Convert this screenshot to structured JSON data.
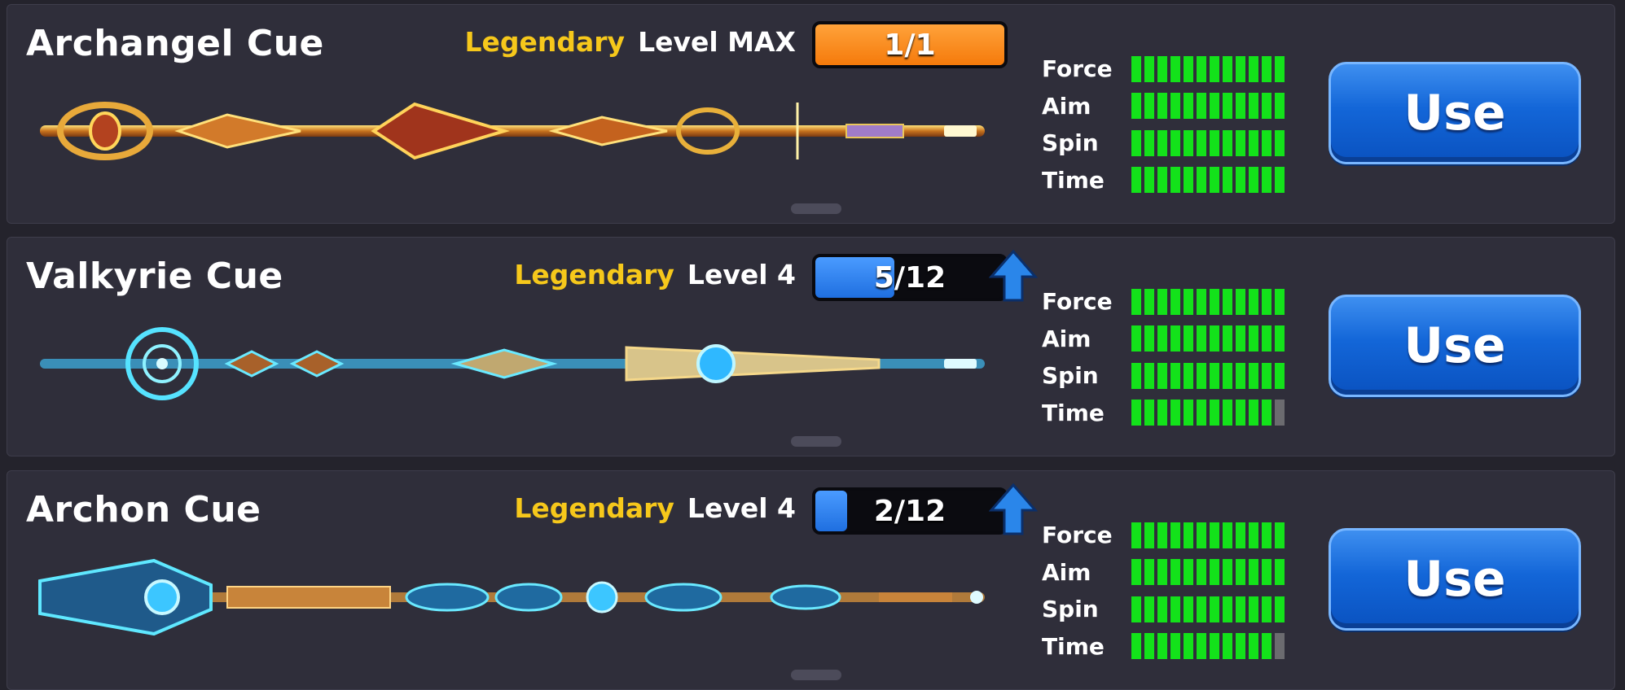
{
  "colors": {
    "rarity": "#f6c81b",
    "stat_on": "#13e21a",
    "stat_off": "#6b6b6f",
    "progress_max": "#f57a0b",
    "progress_blue": "#1f6fe0",
    "use_button": "#1366d8"
  },
  "stat_labels": [
    "Force",
    "Aim",
    "Spin",
    "Time"
  ],
  "stat_max": 12,
  "cues": [
    {
      "name": "Archangel Cue",
      "rarity": "Legendary",
      "level": "Level MAX",
      "progress_text": "1/1",
      "progress_fraction": 1.0,
      "progress_color": "#f57a0b",
      "upgrade_available": false,
      "stats": [
        12,
        12,
        12,
        12
      ],
      "use_label": "Use",
      "art_theme": "gold"
    },
    {
      "name": "Valkyrie Cue",
      "rarity": "Legendary",
      "level": "Level 4",
      "progress_text": "5/12",
      "progress_fraction": 0.4167,
      "progress_color": "#1f6fe0",
      "upgrade_available": true,
      "stats": [
        12,
        12,
        12,
        11
      ],
      "use_label": "Use",
      "art_theme": "cyan"
    },
    {
      "name": "Archon Cue",
      "rarity": "Legendary",
      "level": "Level 4",
      "progress_text": "2/12",
      "progress_fraction": 0.1667,
      "progress_color": "#1f6fe0",
      "upgrade_available": true,
      "stats": [
        12,
        12,
        12,
        11
      ],
      "use_label": "Use",
      "art_theme": "cyan-gold"
    }
  ]
}
